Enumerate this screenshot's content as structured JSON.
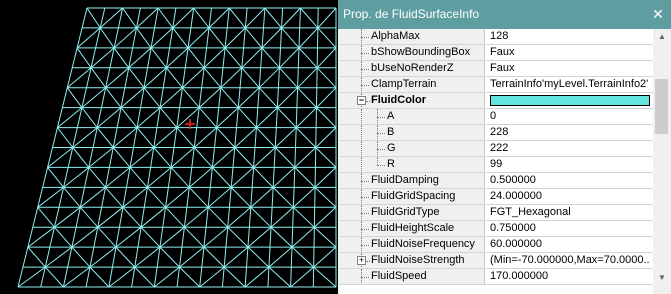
{
  "panel": {
    "title": "Prop. de FluidSurfaceInfo",
    "close_glyph": "✕"
  },
  "colors": {
    "title_bar": "#5f9ea0",
    "mesh_line": "#8ff0f0",
    "cursor": "#ff2020",
    "fluid_color_swatch": "#63e4de"
  },
  "properties": [
    {
      "name": "AlphaMax",
      "value": "128"
    },
    {
      "name": "bShowBoundingBox",
      "value": "Faux"
    },
    {
      "name": "bUseNoRenderZ",
      "value": "Faux"
    },
    {
      "name": "ClampTerrain",
      "value": "TerrainInfo'myLevel.TerrainInfo2'"
    },
    {
      "name": "FluidColor",
      "value": ""
    },
    {
      "name": "A",
      "value": "0"
    },
    {
      "name": "B",
      "value": "228"
    },
    {
      "name": "G",
      "value": "222"
    },
    {
      "name": "R",
      "value": "99"
    },
    {
      "name": "FluidDamping",
      "value": "0.500000"
    },
    {
      "name": "FluidGridSpacing",
      "value": "24.000000"
    },
    {
      "name": "FluidGridType",
      "value": "FGT_Hexagonal"
    },
    {
      "name": "FluidHeightScale",
      "value": "0.750000"
    },
    {
      "name": "FluidNoiseFrequency",
      "value": "60.000000"
    },
    {
      "name": "FluidNoiseStrength",
      "value": "(Min=-70.000000,Max=70.0000..."
    },
    {
      "name": "FluidSpeed",
      "value": "170.000000"
    }
  ]
}
